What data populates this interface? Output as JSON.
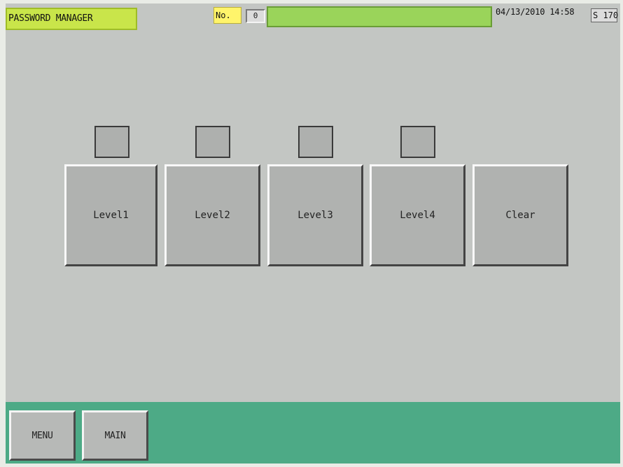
{
  "header": {
    "title": "PASSWORD MANAGER",
    "no_label": "No.",
    "no_value": "0",
    "datetime": "04/13/2010 14:58",
    "s_field": "S 170"
  },
  "levels": [
    {
      "label": "Level1"
    },
    {
      "label": "Level2"
    },
    {
      "label": "Level3"
    },
    {
      "label": "Level4"
    }
  ],
  "clear_label": "Clear",
  "footer": {
    "menu_label": "MENU",
    "main_label": "MAIN"
  },
  "colors": {
    "screen_bg": "#c3c6c3",
    "title_bg": "#c9e54a",
    "no_label_bg": "#fff46b",
    "status_bar": "#9ad45a",
    "footer_bg": "#4daa86"
  }
}
